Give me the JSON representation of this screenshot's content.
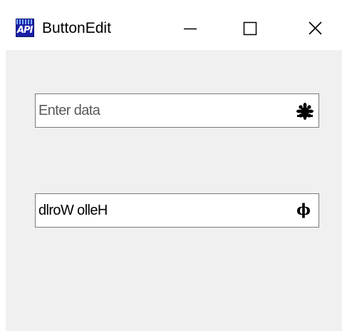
{
  "window": {
    "title": "ButtonEdit",
    "app_icon": "api-app-icon",
    "controls": {
      "minimize_icon": "minimize-icon",
      "maximize_icon": "maximize-icon",
      "close_icon": "close-icon"
    }
  },
  "fields": [
    {
      "value": "",
      "placeholder": "Enter data",
      "button_icon": "splat-icon"
    },
    {
      "value": "dlroW olleH",
      "placeholder": "",
      "button_icon": "phi-icon",
      "button_glyph": "ϕ"
    }
  ],
  "colors": {
    "client_background": "#f0f0f0",
    "titlebar_background": "#ffffff",
    "field_border": "#7a7a7a",
    "icon_blue": "#1a20a6"
  }
}
